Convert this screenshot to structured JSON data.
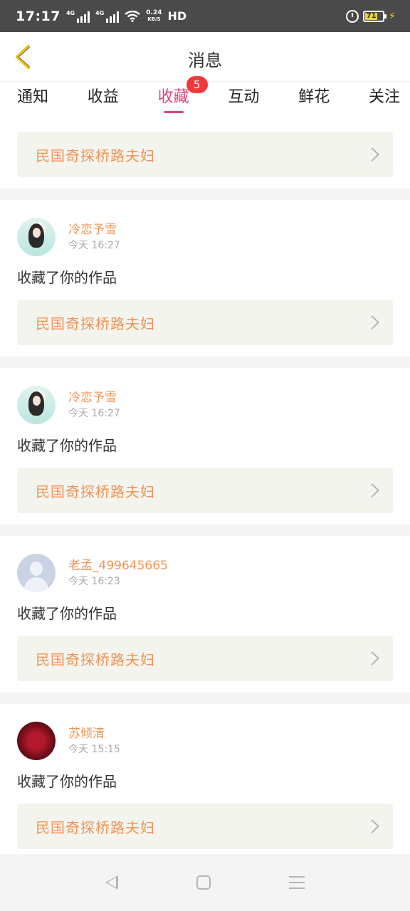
{
  "status_bar": {
    "time": "17:17",
    "network1": "4G",
    "network2": "4G",
    "speed_value": "0.24",
    "speed_unit": "KB/S",
    "hd": "HD",
    "battery": "71"
  },
  "header": {
    "title": "消息"
  },
  "tabs": [
    {
      "label": "通知"
    },
    {
      "label": "收益"
    },
    {
      "label": "收藏",
      "badge": "5",
      "active": true
    },
    {
      "label": "互动"
    },
    {
      "label": "鲜花"
    },
    {
      "label": "关注"
    }
  ],
  "top_card": {
    "work_title": "民国奇探桥路夫妇"
  },
  "items": [
    {
      "user_name": "冷恋予雪",
      "time": "今天 16:27",
      "action": "收藏了你的作品",
      "work_title": "民国奇探桥路夫妇"
    },
    {
      "user_name": "冷恋予雪",
      "time": "今天 16:27",
      "action": "收藏了你的作品",
      "work_title": "民国奇探桥路夫妇"
    },
    {
      "user_name": "老孟_499645665",
      "time": "今天 16:23",
      "action": "收藏了你的作品",
      "work_title": "民国奇探桥路夫妇"
    },
    {
      "user_name": "苏倾清",
      "time": "今天 15:15",
      "action": "收藏了你的作品",
      "work_title": "民国奇探桥路夫妇"
    }
  ],
  "icons": {
    "back": "chevron-left-icon",
    "card_arrow": "chevron-right-icon"
  },
  "colors": {
    "accent_pink": "#e0457b",
    "badge_red": "#f03a3a",
    "name_orange": "#f0955a",
    "back_icon": "#e8c21e"
  }
}
